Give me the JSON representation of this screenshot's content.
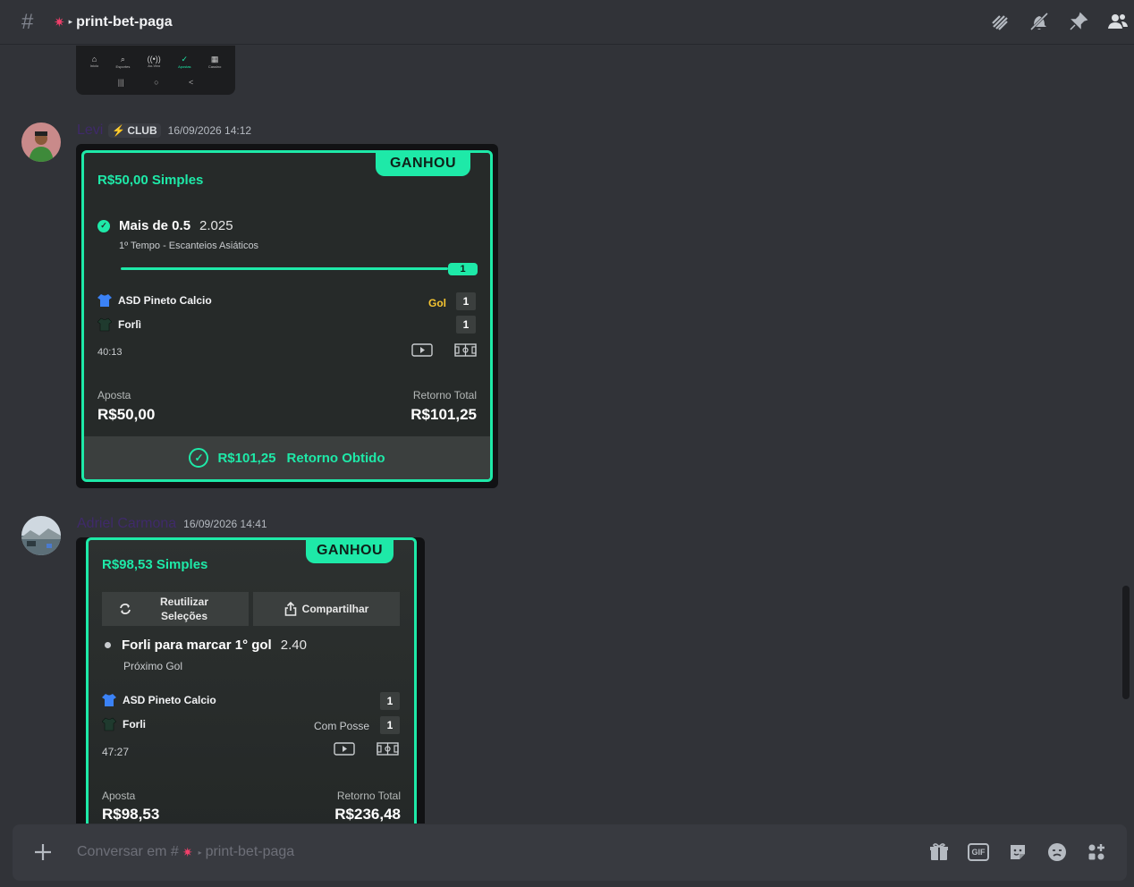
{
  "header": {
    "hash": "#",
    "channel_icon": "✷",
    "channel_marker": "▸",
    "channel_name": "print-bet-paga",
    "icons": [
      "threads-icon",
      "mute-icon",
      "pin-icon",
      "members-icon"
    ]
  },
  "prev_embed": {
    "nav": [
      {
        "icon": "⌂",
        "label": "Início"
      },
      {
        "icon": "⌕",
        "label": "Esportes"
      },
      {
        "icon": "((•))",
        "label": "Ao-Vivo"
      },
      {
        "icon": "✓",
        "label": "Apostas"
      },
      {
        "icon": "▦",
        "label": "Cassino"
      }
    ],
    "sys": [
      "|||",
      "○",
      "<"
    ]
  },
  "messages": [
    {
      "username": "Levi",
      "badge": "CLUB",
      "badge_icon": "⚡",
      "timestamp": "16/09/2026 14:12",
      "bet": {
        "status": "GANHOU",
        "stake_type": "R$50,00  Simples",
        "check": "✓",
        "selection": "Mais de 0.5",
        "odds": "2.025",
        "market": "1º Tempo - Escanteios Asiáticos",
        "progress_badge": "1",
        "progress": 1,
        "home_team": "ASD Pineto Calcio",
        "away_team": "Forlì",
        "home_score": "1",
        "away_score": "1",
        "event_label": "Gol",
        "clock": "40:13",
        "stake_label": "Aposta",
        "stake_value": "R$50,00",
        "return_label": "Retorno Total",
        "return_value": "R$101,25",
        "footer_amount": "R$101,25",
        "footer_text": "Retorno Obtido",
        "home_color": "#3b82f6",
        "away_color": "#1f3a2e"
      }
    },
    {
      "username": "Adriel Carmona",
      "timestamp": "16/09/2026 14:41",
      "bet": {
        "status": "GANHOU",
        "stake_type": "R$98,53  Simples",
        "reuse_label_1": "Reutilizar",
        "reuse_label_2": "Seleções",
        "share_label": "Compartilhar",
        "selection": "Forli para marcar 1° gol",
        "odds": "2.40",
        "market": "Próximo Gol",
        "home_team": "ASD Pineto Calcio",
        "away_team": "Forli",
        "home_score": "1",
        "away_score": "1",
        "event_label": "Com Posse",
        "clock": "47:27",
        "stake_label": "Aposta",
        "stake_value": "R$98,53",
        "return_label": "Retorno Total",
        "return_value": "R$236,48"
      }
    }
  ],
  "composer": {
    "placeholder_prefix": "Conversar em #",
    "channel_icon": "✷",
    "channel_marker": "▸",
    "channel_name": "print-bet-paga",
    "gif_label": "GIF",
    "icons": [
      "gift-icon",
      "gif-icon",
      "sticker-icon",
      "emoji-icon",
      "apps-icon"
    ]
  },
  "colors": {
    "accent": "#1ee9a8",
    "background": "#313338",
    "username": "#3f2a6a",
    "gol": "#f6c531"
  }
}
